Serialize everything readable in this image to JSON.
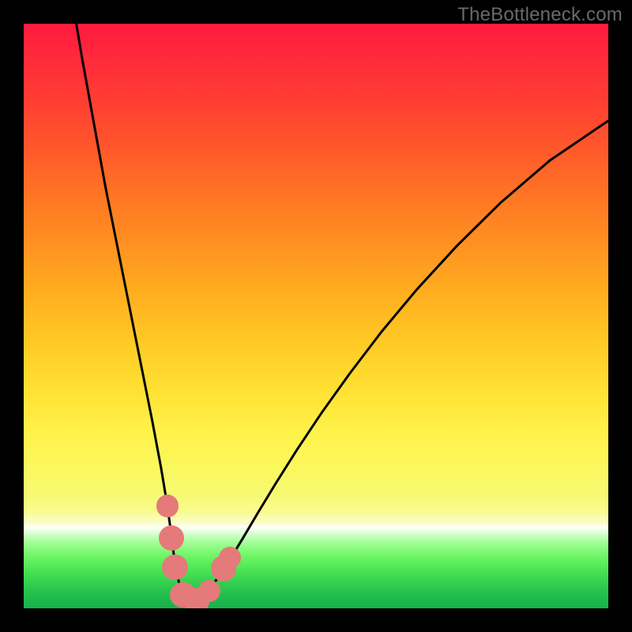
{
  "watermark": "TheBottleneck.com",
  "colors": {
    "frame": "#000000",
    "curve": "#000000",
    "marker": "#e47a7a",
    "watermark_text": "#6a6a6a"
  },
  "chart_data": {
    "type": "line",
    "title": "",
    "xlabel": "",
    "ylabel": "",
    "ylim": [
      0,
      100
    ],
    "xlim": [
      0,
      100
    ],
    "series": [
      {
        "name": "curve",
        "x": [
          9,
          10,
          12,
          14,
          16,
          18,
          20,
          22,
          23.5,
          24.5,
          25.2,
          25.7,
          26.2,
          26.7,
          27.2,
          27.7,
          28.3,
          29.0,
          29.8,
          30.8,
          32.0,
          33.5,
          35.3,
          37.5,
          40.1,
          43.2,
          46.8,
          51.0,
          55.8,
          61.2,
          67.3,
          74.1,
          81.6,
          90.0,
          100.0
        ],
        "y": [
          100,
          94,
          83,
          72,
          62,
          52,
          42,
          32,
          24,
          18,
          13,
          9,
          6,
          3.8,
          2.4,
          1.6,
          1.3,
          1.3,
          1.6,
          2.3,
          3.6,
          5.6,
          8.4,
          12.0,
          16.4,
          21.5,
          27.2,
          33.5,
          40.2,
          47.3,
          54.6,
          62.0,
          69.4,
          76.6,
          83.4
        ]
      }
    ],
    "markers": [
      {
        "x": 24.6,
        "y": 17.5,
        "r": 1.9
      },
      {
        "x": 25.3,
        "y": 12.0,
        "r": 2.2
      },
      {
        "x": 25.9,
        "y": 7.0,
        "r": 2.2
      },
      {
        "x": 27.2,
        "y": 2.3,
        "r": 2.2
      },
      {
        "x": 29.5,
        "y": 1.3,
        "r": 2.2
      },
      {
        "x": 31.8,
        "y": 3.0,
        "r": 1.9
      },
      {
        "x": 34.2,
        "y": 6.8,
        "r": 2.2
      },
      {
        "x": 35.3,
        "y": 8.6,
        "r": 1.9
      }
    ],
    "gradient_bands_pct": {
      "red_start": 0,
      "orange_mid": 40,
      "yellow_mid": 72,
      "white_band": 86,
      "green_end": 100
    }
  }
}
